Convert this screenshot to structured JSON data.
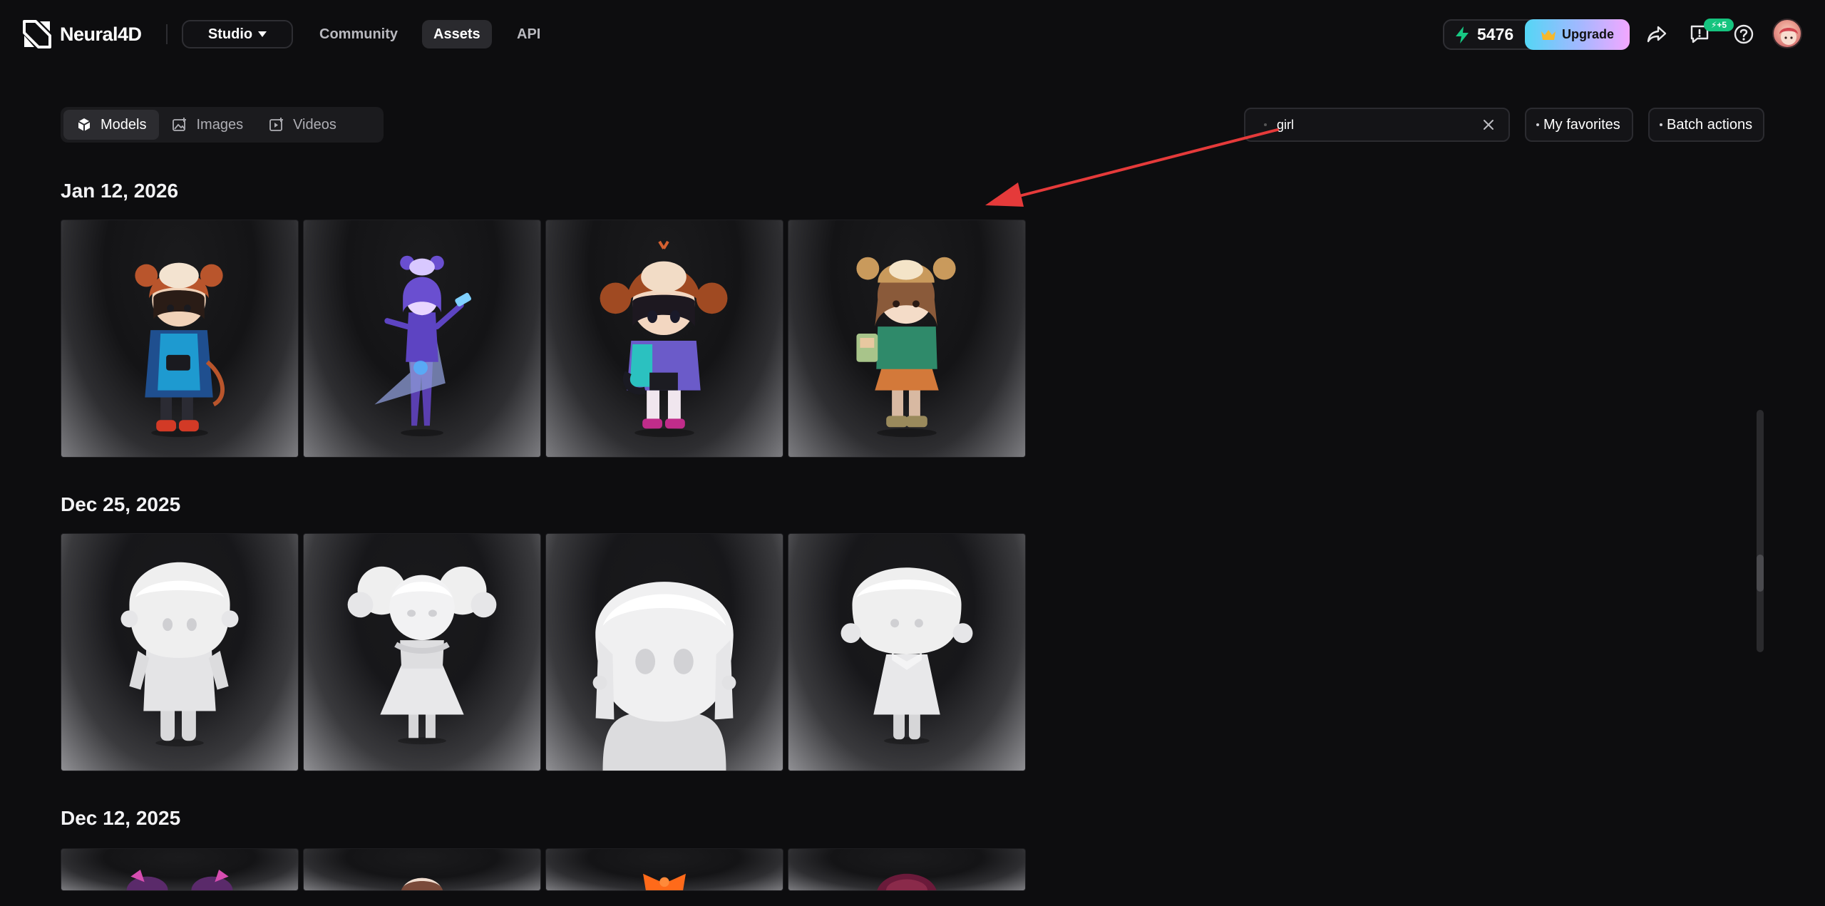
{
  "brand": {
    "name": "Neural4D"
  },
  "nav": {
    "studio_label": "Studio",
    "links": [
      "Community",
      "Assets",
      "API"
    ],
    "active": "Assets"
  },
  "account": {
    "credits": "5476",
    "upgrade_label": "Upgrade",
    "notification_badge": "⚡+5"
  },
  "filters": {
    "tabs": [
      "Models",
      "Images",
      "Videos"
    ],
    "active_tab": "Models",
    "search_value": "girl",
    "favorites_label": "My favorites",
    "batch_label": "Batch actions"
  },
  "sections": [
    {
      "date": "Jan 12, 2026"
    },
    {
      "date": "Dec 25, 2025"
    },
    {
      "date": "Dec 12, 2025"
    }
  ],
  "colors": {
    "background": "#0d0d0f",
    "accent_green": "#16c47f",
    "annotation_red": "#e53a3a"
  }
}
